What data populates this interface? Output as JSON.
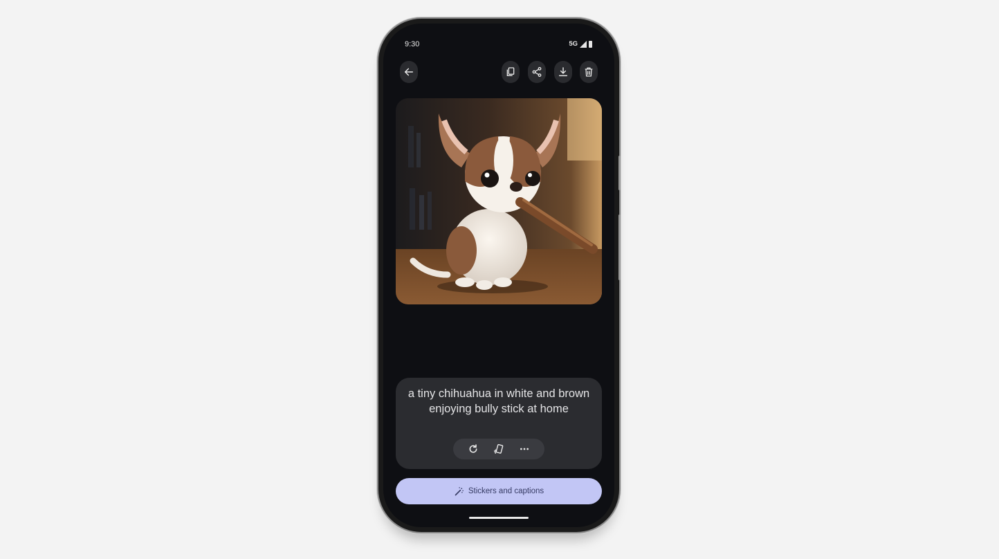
{
  "status_bar": {
    "time": "9:30",
    "network": "5G",
    "signal_icon": "signal-icon",
    "battery_icon": "battery-icon"
  },
  "toolbar": {
    "back_icon": "arrow-left-icon",
    "actions": [
      {
        "name": "copy",
        "icon": "copy-icon"
      },
      {
        "name": "share",
        "icon": "share-icon"
      },
      {
        "name": "download",
        "icon": "download-icon"
      },
      {
        "name": "delete",
        "icon": "trash-icon"
      }
    ]
  },
  "image": {
    "alt": "a tiny chihuahua in white and brown enjoying bully stick at home"
  },
  "prompt": {
    "text": "a tiny chihuahua in white and brown enjoying bully stick at home",
    "actions": [
      {
        "name": "regenerate",
        "icon": "refresh-icon"
      },
      {
        "name": "variations",
        "icon": "cards-icon"
      },
      {
        "name": "more",
        "icon": "more-horizontal-icon"
      }
    ]
  },
  "cta": {
    "label": "Stickers and captions",
    "icon": "magic-wand-icon"
  },
  "colors": {
    "screen_bg": "#0e0f13",
    "card_bg": "#2b2c30",
    "cta_bg": "#c2c6f5",
    "cta_text": "#353a63"
  }
}
